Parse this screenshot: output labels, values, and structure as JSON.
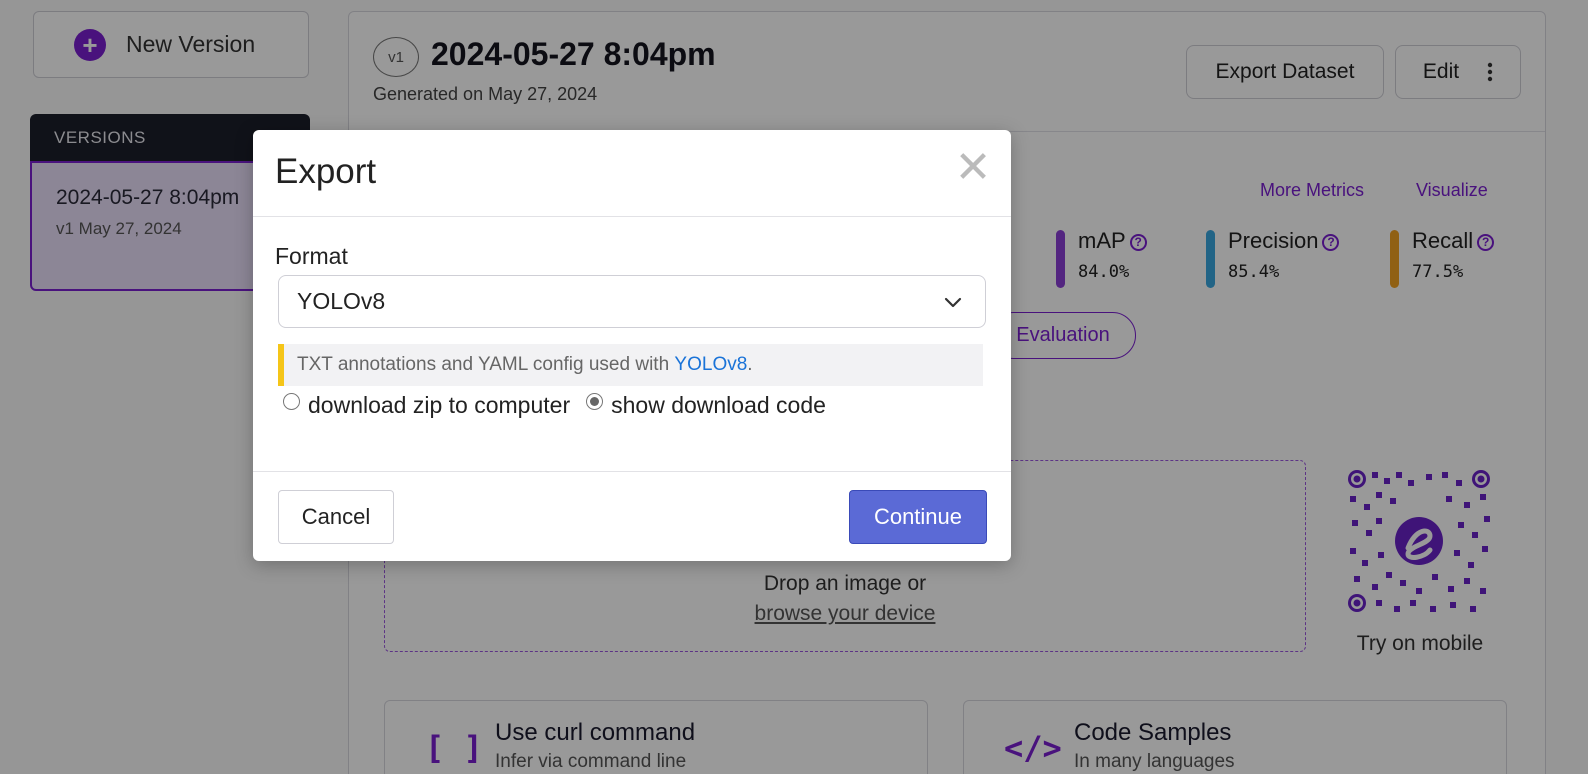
{
  "sidebar": {
    "new_version_label": "New Version",
    "versions_header": "VERSIONS",
    "version": {
      "name": "2024-05-27 8:04pm",
      "meta": "v1 May 27, 2024"
    }
  },
  "main": {
    "badge": "v1",
    "title": "2024-05-27 8:04pm",
    "subtitle": "Generated on May 27, 2024",
    "export_dataset_label": "Export Dataset",
    "edit_label": "Edit",
    "more_metrics_label": "More Metrics",
    "visualize_label": "Visualize",
    "metrics": [
      {
        "label": "mAP",
        "value": "84.0%",
        "color": "#8a3fd6"
      },
      {
        "label": "Precision",
        "value": "85.4%",
        "color": "#3aa7e0"
      },
      {
        "label": "Recall",
        "value": "77.5%",
        "color": "#f0a020"
      }
    ],
    "evaluation_label": "Evaluation",
    "drop_text": "Drop an image or",
    "browse_text": "browse your device",
    "try_mobile": "Try on mobile",
    "cards": [
      {
        "icon": "brackets-icon",
        "glyph": "[ ]",
        "title": "Use curl command",
        "subtitle": "Infer via command line"
      },
      {
        "icon": "code-icon",
        "glyph": "</>",
        "title": "Code Samples",
        "subtitle": "In many languages"
      }
    ]
  },
  "modal": {
    "title": "Export",
    "close_glyph": "✕",
    "format_label": "Format",
    "format_value": "YOLOv8",
    "info_text": "TXT annotations and YAML config used with ",
    "info_link": "YOLOv8",
    "info_suffix": ".",
    "radio_options": [
      {
        "label": "download zip to computer",
        "selected": false
      },
      {
        "label": "show download code",
        "selected": true
      }
    ],
    "cancel_label": "Cancel",
    "continue_label": "Continue"
  },
  "colors": {
    "accent": "#7a1fd1",
    "continue": "#5b6ad6",
    "info_border": "#f5c518",
    "link": "#1a73d8"
  }
}
